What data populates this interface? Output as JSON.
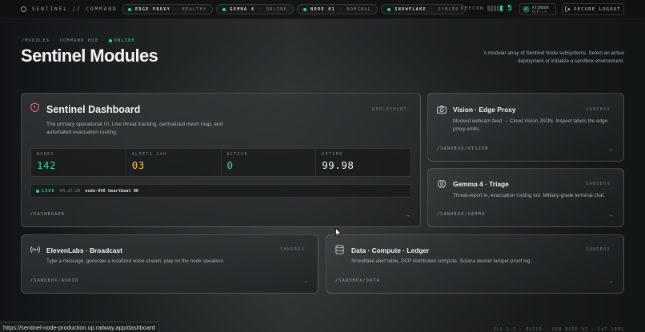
{
  "topbar": {
    "brand": "SENTINEL // COMMAND",
    "pills": [
      {
        "name": "EDGE PROXY",
        "status": "HEALTHY"
      },
      {
        "name": "GEMMA 4",
        "status": "ONLINE"
      },
      {
        "name": "NODE 01",
        "status": "NOMINAL"
      },
      {
        "name": "SNOWFLAKE",
        "status": "SYNCED"
      }
    ],
    "defcon_label": "DEFCON",
    "defcon_level": "5",
    "user": {
      "initials": "AT",
      "name": "ATINDER",
      "clearance": "CLR-L3"
    },
    "logout_label": "SECURE LOGOUT"
  },
  "hero": {
    "crumb_1": "/MODULES",
    "crumb_sep1": "·",
    "crumb_2": "COMMAND HUB",
    "crumb_sep2": "·",
    "crumb_status": "ONLINE",
    "title": "Sentinel Modules",
    "subtitle": "A modular array of Sentinel Node subsystems. Select an active deployment or initialize a sandbox environment."
  },
  "dashboard": {
    "title": "Sentinel Dashboard",
    "tag": "DEPLOYMENT",
    "desc": "The primary operational UI. Live threat tracking, centralized mesh map, and automated evacuation routing.",
    "stats": [
      {
        "label": "NODES",
        "value": "142",
        "color": "#34d399"
      },
      {
        "label": "ALERTS 24H",
        "value": "03",
        "color": "#f5c04a"
      },
      {
        "label": "ACTIVE",
        "value": "0",
        "color": "#34d399"
      },
      {
        "label": "UPTIME",
        "value": "99.98",
        "color": "#eef1f1"
      }
    ],
    "live_label": "LIVE",
    "live_time": "04:27:26",
    "live_msg": "node-098 heartbeat OK",
    "path": "/DASHBOARD"
  },
  "vision": {
    "title": "Vision · Edge Proxy",
    "tag": "SANDBOX",
    "desc": "Mocked webcam feed → Cloud Vision JSON. Inspect labels the edge proxy emits.",
    "path": "/SANDBOX/VISION"
  },
  "gemma": {
    "title": "Gemma 4 · Triage",
    "tag": "SANDBOX",
    "desc": "Threat-report in, evacuation routing out. Military-grade terminal chat.",
    "path": "/SANDBOX/GEMMA"
  },
  "eleven": {
    "title": "ElevenLabs · Broadcast",
    "tag": "SANDBOX",
    "desc": "Type a message, generate a localized voice stream, play on the node speakers.",
    "path": "/SANDBOX/AUDIO"
  },
  "data": {
    "title": "Data · Compute · Ledger",
    "tag": "SANDBOX",
    "desc": "Snowflake alert table, DCP distributed compute, Solana devnet tamper-proof log.",
    "path": "/SANDBOX/DATA"
  },
  "arrow": "→",
  "status_url": "https://sentinel-node-production.up.railway.app/dashboard",
  "footer": "SLS 1.1 · BUILD · GEN NODE-01 · LAT 18MS",
  "icons": {
    "brand": "radar-icon",
    "dashboard": "shield-icon",
    "vision": "camera-icon",
    "gemma": "brain-icon",
    "eleven": "broadcast-icon",
    "data": "database-icon",
    "logout": "logout-icon",
    "cursor": "mouse-pointer-icon"
  }
}
